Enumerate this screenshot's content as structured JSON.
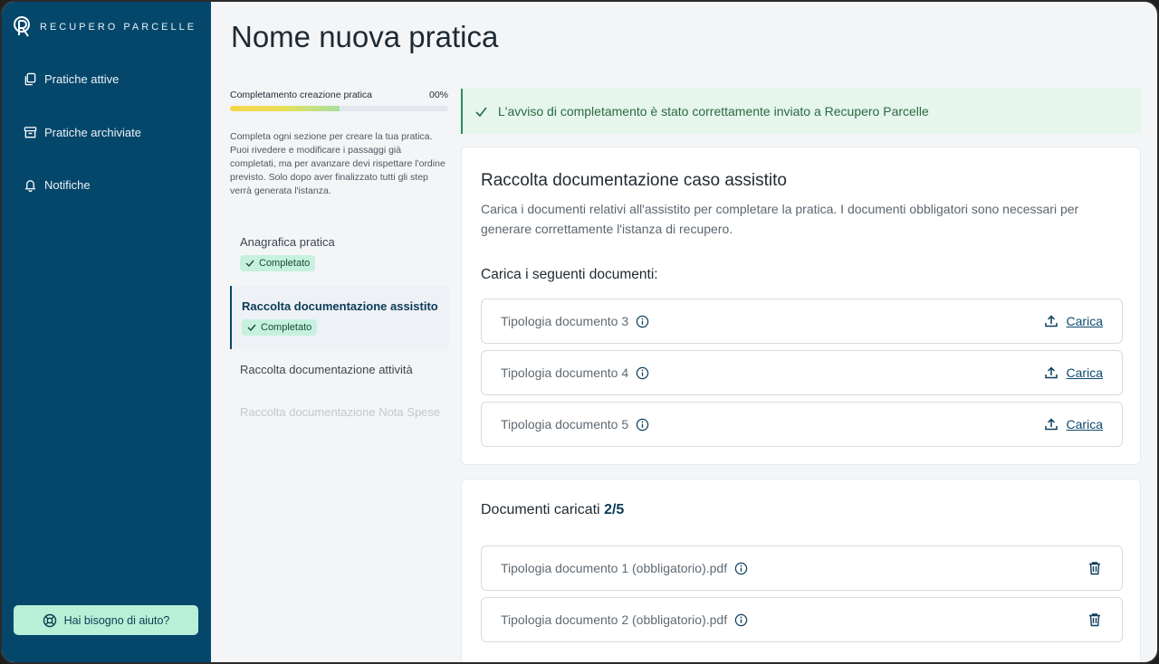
{
  "app": {
    "brand": "RECUPERO PARCELLE"
  },
  "sidebar": {
    "items": [
      {
        "label": "Pratiche attive",
        "icon": "copy-icon"
      },
      {
        "label": "Pratiche archiviate",
        "icon": "archive-icon"
      },
      {
        "label": "Notifiche",
        "icon": "bell-icon"
      }
    ],
    "help_label": "Hai bisogno di aiuto?"
  },
  "page": {
    "title": "Nome nuova pratica"
  },
  "progress": {
    "label": "Completamento creazione pratica",
    "percent_label": "00%",
    "fill_fraction": 0.5
  },
  "instructions": "Completa ogni sezione per creare la tua pratica. Puoi rivedere e modificare i passaggi già completati, ma per avanzare devi rispettare l'ordine previsto. Solo dopo aver finalizzato tutti gli step verrà generata l'istanza.",
  "steps": [
    {
      "label": "Anagrafica pratica",
      "status": "Completato",
      "state": "done"
    },
    {
      "label": "Raccolta documentazione assistito",
      "status": "Completato",
      "state": "active"
    },
    {
      "label": "Raccolta documentazione attività",
      "status": "",
      "state": "pending"
    },
    {
      "label": "Raccolta documentazione Nota Spese",
      "status": "",
      "state": "disabled"
    }
  ],
  "alert": {
    "message": "L'avviso di completamento è stato correttamente inviato a Recupero Parcelle"
  },
  "upload_card": {
    "title": "Raccolta documentazione caso assistito",
    "description": "Carica i documenti relativi all'assistito per completare la pratica. I documenti obbligatori sono necessari per generare correttamente l'istanza di recupero.",
    "subtitle": "Carica i seguenti documenti:",
    "action_label": "Carica",
    "documents": [
      {
        "name": "Tipologia documento 3"
      },
      {
        "name": "Tipologia documento 4"
      },
      {
        "name": "Tipologia documento 5"
      }
    ]
  },
  "uploaded_card": {
    "title": "Documenti caricati",
    "count": "2/5",
    "documents": [
      {
        "name": "Tipologia documento 1 (obbligatorio).pdf"
      },
      {
        "name": "Tipologia documento 2 (obbligatorio).pdf"
      }
    ]
  },
  "colors": {
    "sidebar": "#05476b",
    "help_button": "#b8efd7",
    "success_bg": "#e6f6ec",
    "chip_bg": "#c7f1df",
    "link": "#0d4a6c"
  }
}
